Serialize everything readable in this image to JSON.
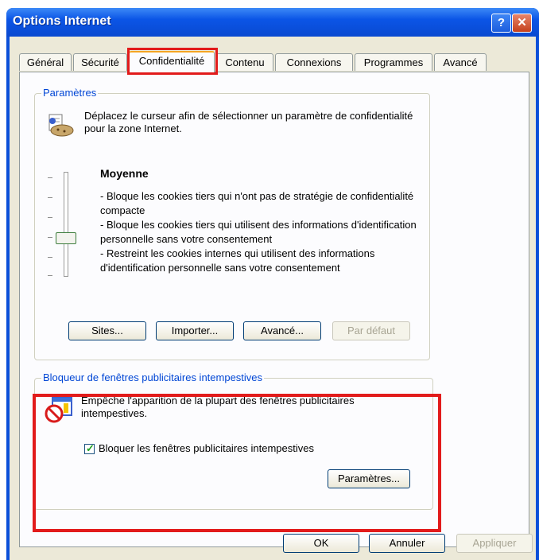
{
  "window": {
    "title": "Options Internet",
    "help_glyph": "?",
    "close_glyph": "✕"
  },
  "tabs": [
    {
      "label": "Général"
    },
    {
      "label": "Sécurité"
    },
    {
      "label": "Confidentialité",
      "active": true
    },
    {
      "label": "Contenu"
    },
    {
      "label": "Connexions"
    },
    {
      "label": "Programmes"
    },
    {
      "label": "Avancé"
    }
  ],
  "settings_group": {
    "legend": "Paramètres",
    "description": "Déplacez le curseur afin de sélectionner un paramètre de confidentialité pour la zone Internet.",
    "level": "Moyenne",
    "bullets": [
      "- Bloque les cookies tiers qui n'ont pas de stratégie de confidentialité compacte",
      "- Bloque les cookies tiers qui utilisent des informations d'identification personnelle sans votre consentement",
      "- Restreint les cookies internes qui utilisent des informations d'identification personnelle sans votre consentement"
    ],
    "buttons": {
      "sites": "Sites...",
      "import": "Importer...",
      "advanced": "Avancé...",
      "default": "Par défaut"
    }
  },
  "popup_group": {
    "legend": "Bloqueur de fenêtres publicitaires intempestives",
    "description": "Empêche l'apparition de la plupart des fenêtres publicitaires intempestives.",
    "checkbox_label": "Bloquer les fenêtres publicitaires intempestives",
    "checked": true,
    "settings_button": "Paramètres..."
  },
  "footer": {
    "ok": "OK",
    "cancel": "Annuler",
    "apply": "Appliquer"
  },
  "colors": {
    "highlight": "#e21b1b",
    "legend_text": "#0046d5",
    "titlebar": "#0a55e6"
  },
  "icons": [
    "help-icon",
    "close-icon",
    "privacy-cookie-icon",
    "popup-blocker-icon",
    "checkmark-icon"
  ]
}
